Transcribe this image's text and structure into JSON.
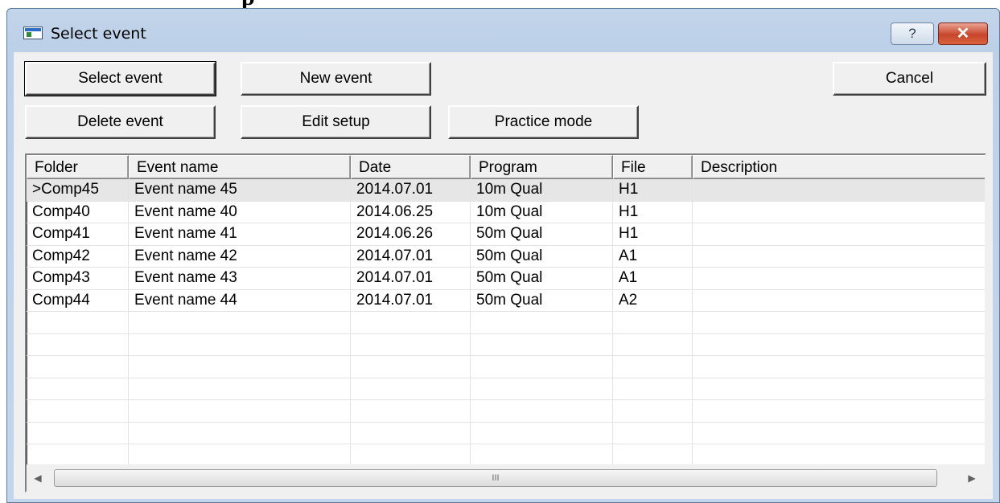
{
  "cropped_heading": "p",
  "window": {
    "title": "Select event",
    "help_label": "?",
    "close_label": "✕"
  },
  "toolbar": {
    "select_event": "Select event",
    "new_event": "New event",
    "cancel": "Cancel",
    "delete_event": "Delete event",
    "edit_setup": "Edit setup",
    "practice_mode": "Practice mode"
  },
  "table": {
    "columns": [
      "Folder",
      "Event name",
      "Date",
      "Program",
      "File",
      "Description"
    ],
    "rows": [
      {
        "folder": ">Comp45",
        "event_name": "Event name 45",
        "date": "2014.07.01",
        "program": "10m Qual",
        "file": "H1",
        "description": ""
      },
      {
        "folder": "Comp40",
        "event_name": "Event name 40",
        "date": "2014.06.25",
        "program": "10m Qual",
        "file": "H1",
        "description": ""
      },
      {
        "folder": "Comp41",
        "event_name": "Event name 41",
        "date": "2014.06.26",
        "program": "50m Qual",
        "file": "H1",
        "description": ""
      },
      {
        "folder": "Comp42",
        "event_name": "Event name 42",
        "date": "2014.07.01",
        "program": "50m Qual",
        "file": "A1",
        "description": ""
      },
      {
        "folder": "Comp43",
        "event_name": "Event name 43",
        "date": "2014.07.01",
        "program": "50m Qual",
        "file": "A1",
        "description": ""
      },
      {
        "folder": "Comp44",
        "event_name": "Event name 44",
        "date": "2014.07.01",
        "program": "50m Qual",
        "file": "A2",
        "description": ""
      }
    ],
    "empty_row_count": 7,
    "selected_row_index": 0
  },
  "scrollbar": {
    "left_arrow": "◀",
    "right_arrow": "▶",
    "grip": "III"
  },
  "colors": {
    "titlebar": "#bcd0e8",
    "close_button": "#c8452b",
    "dialog_face": "#f0f0f0",
    "selected_row": "#e6e6e6"
  }
}
